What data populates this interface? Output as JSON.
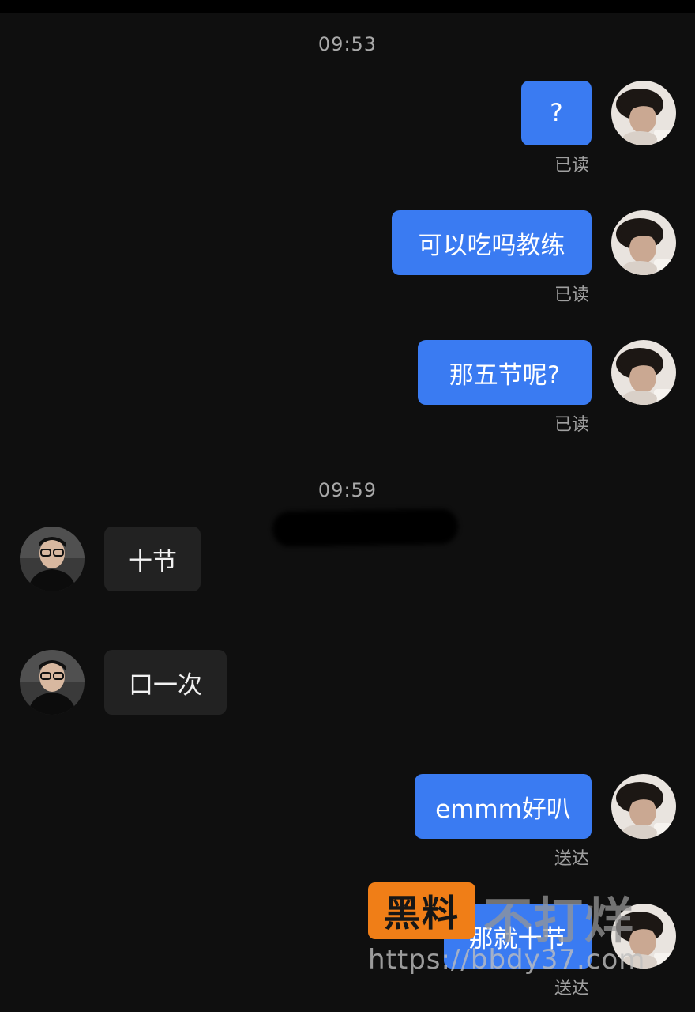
{
  "timestamps": [
    "09:53",
    "09:59"
  ],
  "messages": [
    {
      "side": "out",
      "text": "?",
      "status": "已读"
    },
    {
      "side": "out",
      "text": "可以吃吗教练",
      "status": "已读"
    },
    {
      "side": "out",
      "text": "那五节呢?",
      "status": "已读"
    },
    {
      "side": "in",
      "text": "十节"
    },
    {
      "side": "in",
      "text": "口一次"
    },
    {
      "side": "out",
      "text": "emmm好叭",
      "status": "送达"
    },
    {
      "side": "out",
      "text": "那就十节",
      "status": "送达"
    }
  ],
  "watermark": {
    "badge": "黑料",
    "text": "不打烊",
    "url": "https://bbdy37.com"
  },
  "colors": {
    "background": "#0f0f0f",
    "outgoing_bubble": "#3a7bf2",
    "incoming_bubble": "#222222",
    "watermark_badge": "#f07e17"
  }
}
